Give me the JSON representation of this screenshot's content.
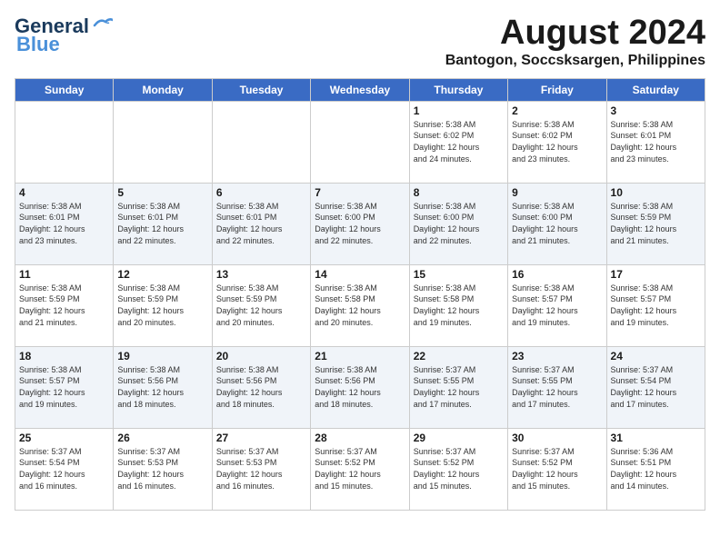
{
  "header": {
    "logo_line1": "General",
    "logo_line2": "Blue",
    "title": "August 2024",
    "subtitle": "Bantogon, Soccsksargen, Philippines"
  },
  "weekdays": [
    "Sunday",
    "Monday",
    "Tuesday",
    "Wednesday",
    "Thursday",
    "Friday",
    "Saturday"
  ],
  "weeks": [
    [
      {
        "day": "",
        "info": ""
      },
      {
        "day": "",
        "info": ""
      },
      {
        "day": "",
        "info": ""
      },
      {
        "day": "",
        "info": ""
      },
      {
        "day": "1",
        "info": "Sunrise: 5:38 AM\nSunset: 6:02 PM\nDaylight: 12 hours\nand 24 minutes."
      },
      {
        "day": "2",
        "info": "Sunrise: 5:38 AM\nSunset: 6:02 PM\nDaylight: 12 hours\nand 23 minutes."
      },
      {
        "day": "3",
        "info": "Sunrise: 5:38 AM\nSunset: 6:01 PM\nDaylight: 12 hours\nand 23 minutes."
      }
    ],
    [
      {
        "day": "4",
        "info": "Sunrise: 5:38 AM\nSunset: 6:01 PM\nDaylight: 12 hours\nand 23 minutes."
      },
      {
        "day": "5",
        "info": "Sunrise: 5:38 AM\nSunset: 6:01 PM\nDaylight: 12 hours\nand 22 minutes."
      },
      {
        "day": "6",
        "info": "Sunrise: 5:38 AM\nSunset: 6:01 PM\nDaylight: 12 hours\nand 22 minutes."
      },
      {
        "day": "7",
        "info": "Sunrise: 5:38 AM\nSunset: 6:00 PM\nDaylight: 12 hours\nand 22 minutes."
      },
      {
        "day": "8",
        "info": "Sunrise: 5:38 AM\nSunset: 6:00 PM\nDaylight: 12 hours\nand 22 minutes."
      },
      {
        "day": "9",
        "info": "Sunrise: 5:38 AM\nSunset: 6:00 PM\nDaylight: 12 hours\nand 21 minutes."
      },
      {
        "day": "10",
        "info": "Sunrise: 5:38 AM\nSunset: 5:59 PM\nDaylight: 12 hours\nand 21 minutes."
      }
    ],
    [
      {
        "day": "11",
        "info": "Sunrise: 5:38 AM\nSunset: 5:59 PM\nDaylight: 12 hours\nand 21 minutes."
      },
      {
        "day": "12",
        "info": "Sunrise: 5:38 AM\nSunset: 5:59 PM\nDaylight: 12 hours\nand 20 minutes."
      },
      {
        "day": "13",
        "info": "Sunrise: 5:38 AM\nSunset: 5:59 PM\nDaylight: 12 hours\nand 20 minutes."
      },
      {
        "day": "14",
        "info": "Sunrise: 5:38 AM\nSunset: 5:58 PM\nDaylight: 12 hours\nand 20 minutes."
      },
      {
        "day": "15",
        "info": "Sunrise: 5:38 AM\nSunset: 5:58 PM\nDaylight: 12 hours\nand 19 minutes."
      },
      {
        "day": "16",
        "info": "Sunrise: 5:38 AM\nSunset: 5:57 PM\nDaylight: 12 hours\nand 19 minutes."
      },
      {
        "day": "17",
        "info": "Sunrise: 5:38 AM\nSunset: 5:57 PM\nDaylight: 12 hours\nand 19 minutes."
      }
    ],
    [
      {
        "day": "18",
        "info": "Sunrise: 5:38 AM\nSunset: 5:57 PM\nDaylight: 12 hours\nand 19 minutes."
      },
      {
        "day": "19",
        "info": "Sunrise: 5:38 AM\nSunset: 5:56 PM\nDaylight: 12 hours\nand 18 minutes."
      },
      {
        "day": "20",
        "info": "Sunrise: 5:38 AM\nSunset: 5:56 PM\nDaylight: 12 hours\nand 18 minutes."
      },
      {
        "day": "21",
        "info": "Sunrise: 5:38 AM\nSunset: 5:56 PM\nDaylight: 12 hours\nand 18 minutes."
      },
      {
        "day": "22",
        "info": "Sunrise: 5:37 AM\nSunset: 5:55 PM\nDaylight: 12 hours\nand 17 minutes."
      },
      {
        "day": "23",
        "info": "Sunrise: 5:37 AM\nSunset: 5:55 PM\nDaylight: 12 hours\nand 17 minutes."
      },
      {
        "day": "24",
        "info": "Sunrise: 5:37 AM\nSunset: 5:54 PM\nDaylight: 12 hours\nand 17 minutes."
      }
    ],
    [
      {
        "day": "25",
        "info": "Sunrise: 5:37 AM\nSunset: 5:54 PM\nDaylight: 12 hours\nand 16 minutes."
      },
      {
        "day": "26",
        "info": "Sunrise: 5:37 AM\nSunset: 5:53 PM\nDaylight: 12 hours\nand 16 minutes."
      },
      {
        "day": "27",
        "info": "Sunrise: 5:37 AM\nSunset: 5:53 PM\nDaylight: 12 hours\nand 16 minutes."
      },
      {
        "day": "28",
        "info": "Sunrise: 5:37 AM\nSunset: 5:52 PM\nDaylight: 12 hours\nand 15 minutes."
      },
      {
        "day": "29",
        "info": "Sunrise: 5:37 AM\nSunset: 5:52 PM\nDaylight: 12 hours\nand 15 minutes."
      },
      {
        "day": "30",
        "info": "Sunrise: 5:37 AM\nSunset: 5:52 PM\nDaylight: 12 hours\nand 15 minutes."
      },
      {
        "day": "31",
        "info": "Sunrise: 5:36 AM\nSunset: 5:51 PM\nDaylight: 12 hours\nand 14 minutes."
      }
    ]
  ]
}
